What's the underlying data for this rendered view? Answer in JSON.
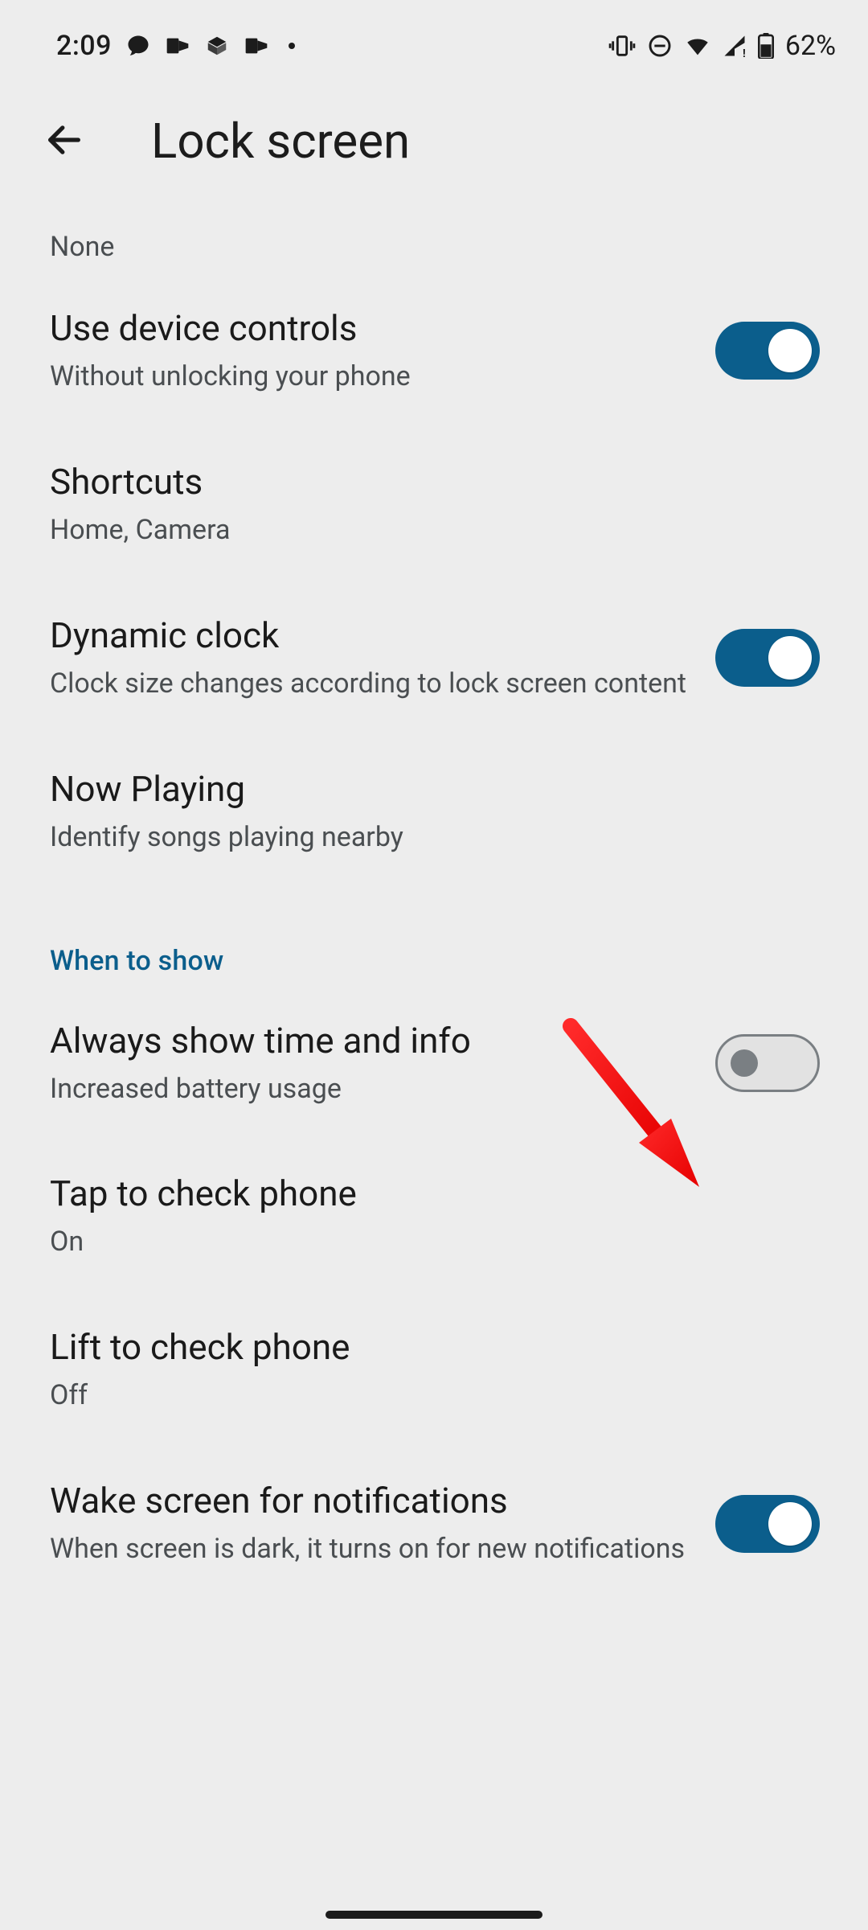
{
  "statusbar": {
    "time": "2:09",
    "battery": "62%"
  },
  "appbar": {
    "title": "Lock screen"
  },
  "orphan_prev_subtitle": "None",
  "items": {
    "device_controls": {
      "title": "Use device controls",
      "subtitle": "Without unlocking your phone"
    },
    "shortcuts": {
      "title": "Shortcuts",
      "subtitle": "Home, Camera"
    },
    "dynamic_clock": {
      "title": "Dynamic clock",
      "subtitle": "Clock size changes according to lock screen content"
    },
    "now_playing": {
      "title": "Now Playing",
      "subtitle": "Identify songs playing nearby"
    },
    "always_show": {
      "title": "Always show time and info",
      "subtitle": "Increased battery usage"
    },
    "tap_to_check": {
      "title": "Tap to check phone",
      "subtitle": "On"
    },
    "lift_to_check": {
      "title": "Lift to check phone",
      "subtitle": "Off"
    },
    "wake_for_notif": {
      "title": "Wake screen for notifications",
      "subtitle": "When screen is dark, it turns on for new notifications"
    }
  },
  "section_header": "When to show"
}
